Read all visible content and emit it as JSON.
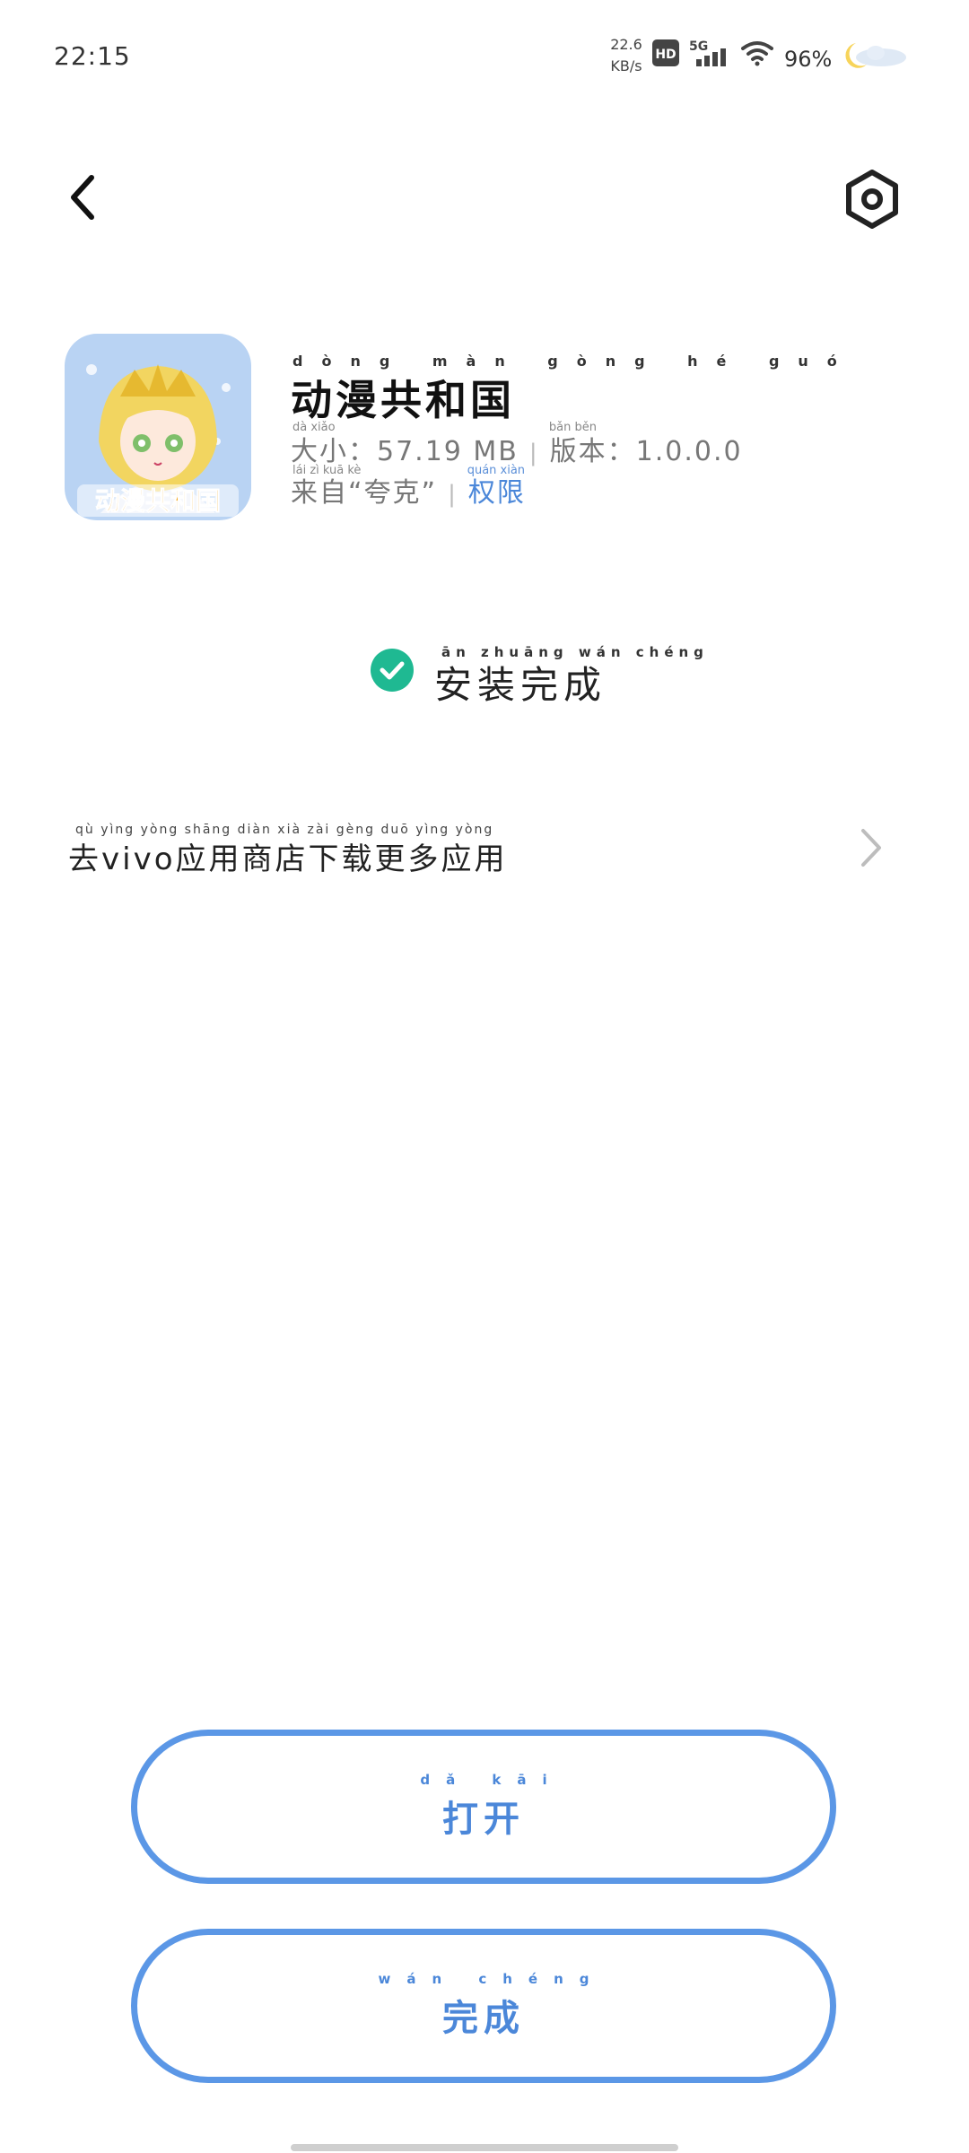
{
  "status_bar": {
    "time": "22:15",
    "net_speed_value": "22.6",
    "net_speed_unit": "KB/s",
    "hd_label": "HD",
    "network_label": "5G",
    "battery": "96%",
    "icons": [
      "hd-icon",
      "signal-5g-icon",
      "wifi-icon",
      "moon-cloud-icon"
    ]
  },
  "nav": {
    "back_icon": "back-arrow-icon",
    "settings_icon": "settings-hexagon-icon"
  },
  "app": {
    "name_pinyin": "dòng màn gòng hé guó",
    "name": "动漫共和国",
    "icon_label": "动漫共和国",
    "size_pinyin": "dà xiǎo",
    "size_label": "大小：",
    "size_value": "57.19 MB",
    "version_pinyin": "bǎn běn",
    "version_label": "版本：",
    "version_value": "1.0.0.0",
    "source_pinyin": "lái zì  kuā kè",
    "source_text": "来自“夸克”",
    "permission_pinyin": "quán xiàn",
    "permission_label": "权限"
  },
  "install_status": {
    "pinyin": "ān zhuāng wán chéng",
    "text": "安装完成",
    "icon": "check-circle-icon",
    "color": "#1fb992"
  },
  "store_link": {
    "pinyin": "qù   yìng yòng shāng diàn xià zài gèng duō yìng yòng",
    "text": "去vivo应用商店下载更多应用"
  },
  "buttons": {
    "open_pinyin": "dǎ kāi",
    "open_label": "打开",
    "finish_pinyin": "wán chéng",
    "finish_label": "完成",
    "accent": "#5b97e6"
  }
}
